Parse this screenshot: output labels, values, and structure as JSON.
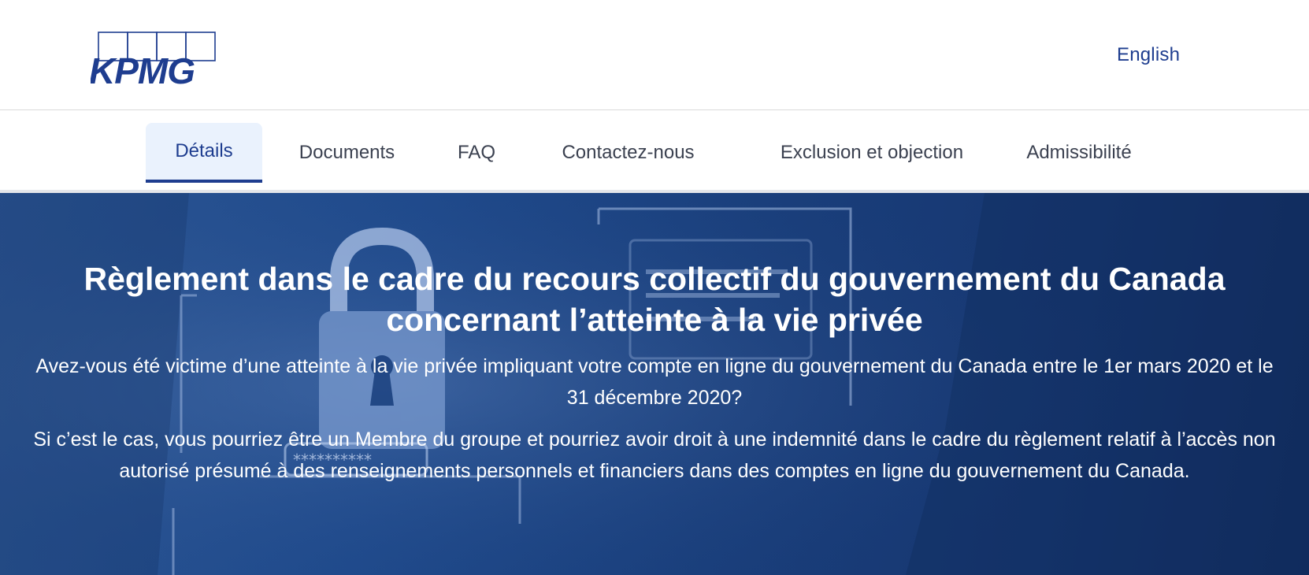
{
  "header": {
    "logo_text": "KPMG",
    "language_link": "English"
  },
  "tabs": [
    {
      "label": "Détails",
      "active": true
    },
    {
      "label": "Documents",
      "active": false
    },
    {
      "label": "FAQ",
      "active": false
    },
    {
      "label": "Contactez-nous",
      "active": false
    },
    {
      "label": "Exclusion et objection",
      "active": false
    },
    {
      "label": "Admissibilité",
      "active": false
    }
  ],
  "hero": {
    "title": "Règlement dans le cadre du recours collectif du gouvernement du Canada concernant l’atteinte à la vie privée",
    "paragraph_1": "Avez-vous été victime d’une atteinte à la vie privée impliquant votre compte en ligne du gouvernement du Canada entre le 1er mars 2020 et le 31 décembre 2020?",
    "paragraph_2": "Si c’est le cas, vous pourriez être un Membre du groupe et pourriez avoir droit à une indemnité dans le cadre du règlement relatif à l’accès non autorisé présumé à des renseignements personnels et financiers dans des comptes en ligne du gouvernement du Canada.",
    "password_mask": "**********"
  },
  "colors": {
    "brand_blue": "#1e3d8f",
    "active_tab_bg": "#eaf2fd",
    "hero_blue": "#1a3f7c"
  }
}
